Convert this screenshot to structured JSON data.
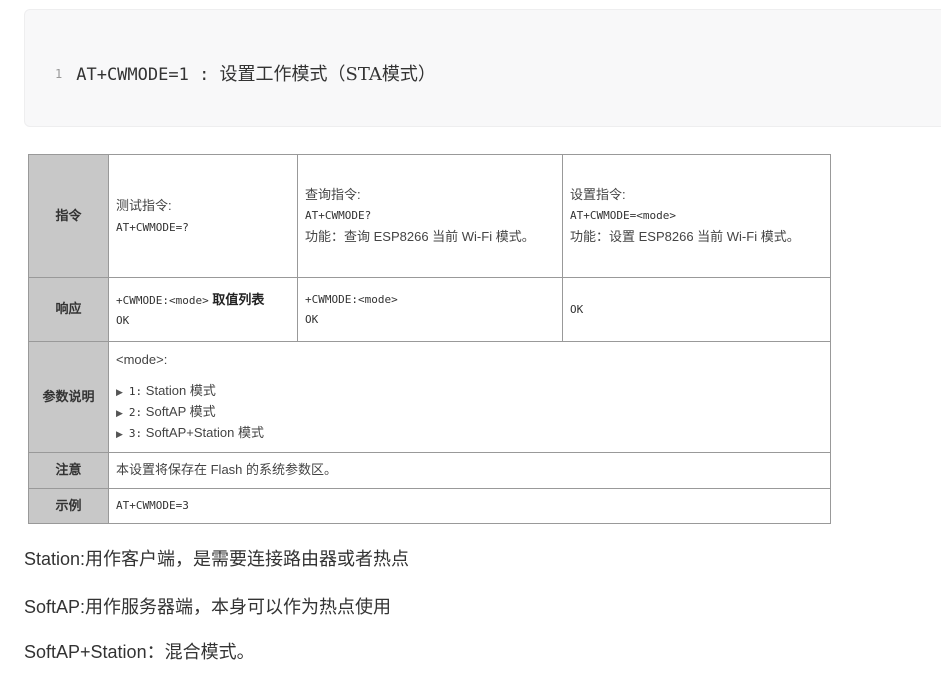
{
  "code": {
    "line_number": "1",
    "command": "AT+CWMODE=1",
    "separator": " : ",
    "comment": "设置工作模式（STA模式）"
  },
  "table": {
    "rows": {
      "command": {
        "header": "指令",
        "test_label": "测试指令:",
        "test_cmd": "AT+CWMODE=?",
        "query_label": "查询指令:",
        "query_cmd": "AT+CWMODE?",
        "query_desc": "功能：查询 ESP8266 当前 Wi-Fi 模式。",
        "set_label": "设置指令:",
        "set_cmd": "AT+CWMODE=<mode>",
        "set_desc": "功能：设置 ESP8266 当前 Wi-Fi 模式。"
      },
      "response": {
        "header": "响应",
        "test_resp_code": "+CWMODE:<mode>",
        "test_resp_bold": "取值列表",
        "test_resp_ok": "OK",
        "query_resp_code": "+CWMODE:<mode>",
        "query_resp_ok": "OK",
        "set_resp": "OK"
      },
      "params": {
        "header": "参数说明",
        "intro": "<mode>:",
        "items": [
          {
            "num": "1:",
            "text": "Station 模式"
          },
          {
            "num": "2:",
            "text": "SoftAP 模式"
          },
          {
            "num": "3:",
            "text": "SoftAP+Station 模式"
          }
        ]
      },
      "note": {
        "header": "注意",
        "text": "本设置将保存在 Flash 的系统参数区。"
      },
      "example": {
        "header": "示例",
        "text": "AT+CWMODE=3"
      }
    }
  },
  "paragraphs": [
    "Station:用作客户端，是需要连接路由器或者热点",
    "SoftAP:用作服务器端，本身可以作为热点使用",
    "SoftAP+Station：混合模式。"
  ]
}
